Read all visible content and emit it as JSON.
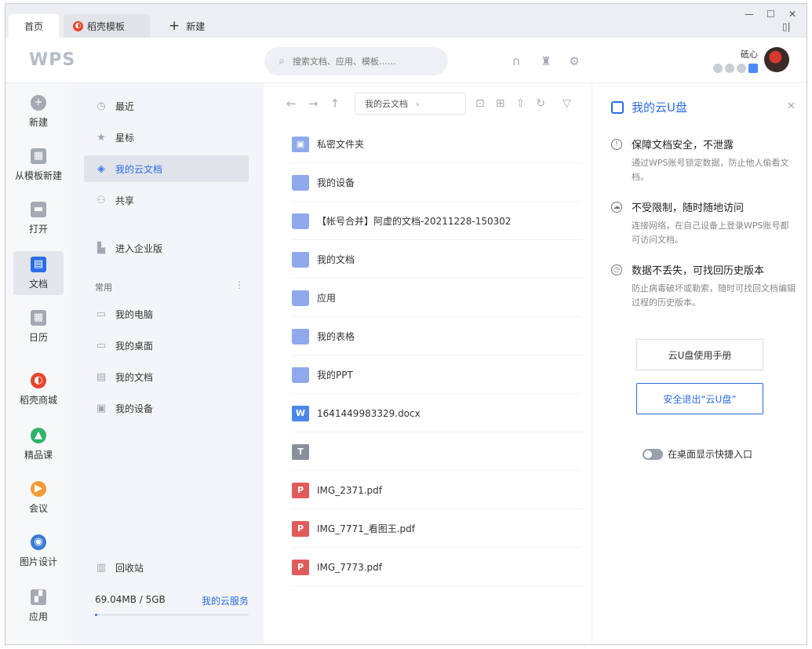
{
  "tabs": {
    "home": "首页",
    "daoke": "稻壳模板",
    "new": "新建"
  },
  "header": {
    "logo": "WPS",
    "search_placeholder": "搜索文档、应用、模板……",
    "username": "砥心"
  },
  "rail": [
    {
      "label": "新建",
      "icon": "plus-icon",
      "color": "#a4a9b3"
    },
    {
      "label": "从模板新建",
      "icon": "template-icon",
      "color": "#a4a9b3"
    },
    {
      "label": "打开",
      "icon": "folder-open-icon",
      "color": "#a4a9b3"
    },
    {
      "label": "文档",
      "icon": "document-icon",
      "color": "#2b6de4"
    },
    {
      "label": "日历",
      "icon": "calendar-icon",
      "color": "#a4a9b3"
    },
    {
      "label": "稻壳商城",
      "icon": "daoke-icon",
      "color": "#e8452c"
    },
    {
      "label": "精品课",
      "icon": "graduation-cap-icon",
      "color": "#2fb36a"
    },
    {
      "label": "会议",
      "icon": "video-meeting-icon",
      "color": "#f29b38"
    },
    {
      "label": "图片设计",
      "icon": "image-design-icon",
      "color": "#3a7bd5"
    },
    {
      "label": "应用",
      "icon": "apps-icon",
      "color": "#a4a9b3"
    }
  ],
  "nav": {
    "recent": "最近",
    "starred": "星标",
    "cloud": "我的云文档",
    "shared": "共享",
    "enterprise": "进入企业版",
    "common_label": "常用",
    "more": "⋮",
    "common": [
      "我的电脑",
      "我的桌面",
      "我的文档",
      "我的设备"
    ],
    "trash": "回收站",
    "storage": "69.04MB / 5GB",
    "storage_fraction": 0.014,
    "cloud_service": "我的云服务"
  },
  "path": {
    "current": "我的云文档"
  },
  "files": [
    {
      "name": "私密文件夹",
      "type": "lock"
    },
    {
      "name": "我的设备",
      "type": "folder"
    },
    {
      "name": "【帐号合并】阿虚的文档-20211228-150302",
      "type": "folder"
    },
    {
      "name": "我的文档",
      "type": "folder"
    },
    {
      "name": "应用",
      "type": "folder"
    },
    {
      "name": "我的表格",
      "type": "folder"
    },
    {
      "name": "我的PPT",
      "type": "folder"
    },
    {
      "name": "1641449983329.docx",
      "type": "doc"
    },
    {
      "name": "",
      "type": "txt"
    },
    {
      "name": "IMG_2371.pdf",
      "type": "pdf"
    },
    {
      "name": "IMG_7771_看图王.pdf",
      "type": "pdf"
    },
    {
      "name": "IMG_7773.pdf",
      "type": "pdf"
    }
  ],
  "panel": {
    "title": "我的云U盘",
    "features": [
      {
        "title": "保障文档安全，不泄露",
        "desc": "通过WPS账号锁定数据，防止他人偷看文档。"
      },
      {
        "title": "不受限制，随时随地访问",
        "desc": "连接网络，在自己设备上登录WPS账号都可访问文档。"
      },
      {
        "title": "数据不丢失，可找回历史版本",
        "desc": "防止病毒破坏或勒索，随时可找回文档编辑过程的历史版本。"
      }
    ],
    "manual_button": "云U盘使用手册",
    "exit_button": "安全退出“云U盘”",
    "toggle_label": "在桌面显示快捷入口"
  }
}
